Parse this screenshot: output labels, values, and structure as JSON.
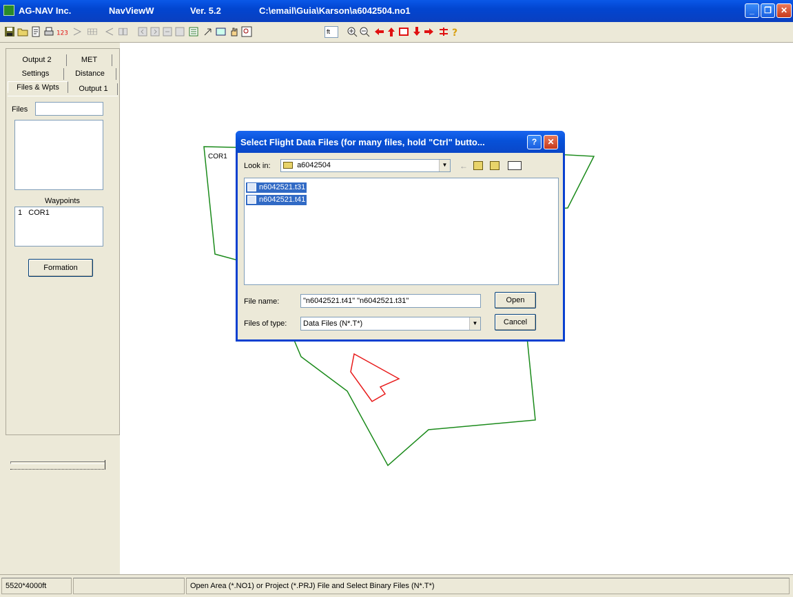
{
  "window": {
    "company": "AG-NAV Inc.",
    "app_name": "NavViewW",
    "version": "Ver. 5.2",
    "file_path": "C:\\email\\Guia\\Karson\\a6042504.no1",
    "minimize_label": "_",
    "restore_label": "❐",
    "close_label": "✕"
  },
  "toolbar": {
    "icons": [
      "save-icon",
      "open-folder-icon",
      "file-icon",
      "print-icon",
      "number-123-icon",
      "forward-arrow-icon",
      "grid-icon",
      "back-arrow-icon",
      "book-icon",
      "square-icon-1",
      "square-icon-2",
      "square-icon-3",
      "square-icon-4",
      "list-icon",
      "pointer-icon",
      "rectangle-icon",
      "hand-icon",
      "zoom-box-icon",
      "zoom-in-icon",
      "zoom-out-icon",
      "arrow-left-icon",
      "arrow-up-icon",
      "center-icon",
      "arrow-down-icon",
      "arrow-right-icon",
      "scale-icon",
      "help-icon"
    ],
    "unit_value": "ft"
  },
  "left_panel": {
    "tabs_row1": [
      "Output 2",
      "MET"
    ],
    "tabs_row2": [
      "Settings",
      "Distance"
    ],
    "tabs_row3": [
      "Files & Wpts",
      "Output 1"
    ],
    "files_label": "Files",
    "files_value": "",
    "waypoints_label": "Waypoints",
    "waypoints": [
      {
        "num": "1",
        "name": "COR1"
      }
    ],
    "formation_button": "Formation"
  },
  "map": {
    "polygon_label": "COR1",
    "colors": {
      "boundary": "#1a8a1a",
      "area": "#e81a1a"
    }
  },
  "dialog": {
    "title": "Select Flight Data Files (for many files, hold \"Ctrl\" butto...",
    "help_label": "?",
    "close_label": "✕",
    "look_in_label": "Look in:",
    "look_in_value": "a6042504",
    "files": [
      "n6042521.t31",
      "n6042521.t41"
    ],
    "file_name_label": "File name:",
    "file_name_value": "\"n6042521.t41\" \"n6042521.t31\"",
    "files_of_type_label": "Files of type:",
    "files_of_type_value": "Data Files (N*.T*)",
    "open_button": "Open",
    "cancel_button": "Cancel"
  },
  "status_bar": {
    "dimensions": "5520*4000ft",
    "blank": "",
    "message": "Open Area (*.NO1) or Project (*.PRJ) File and Select Binary Files (N*.T*)"
  }
}
